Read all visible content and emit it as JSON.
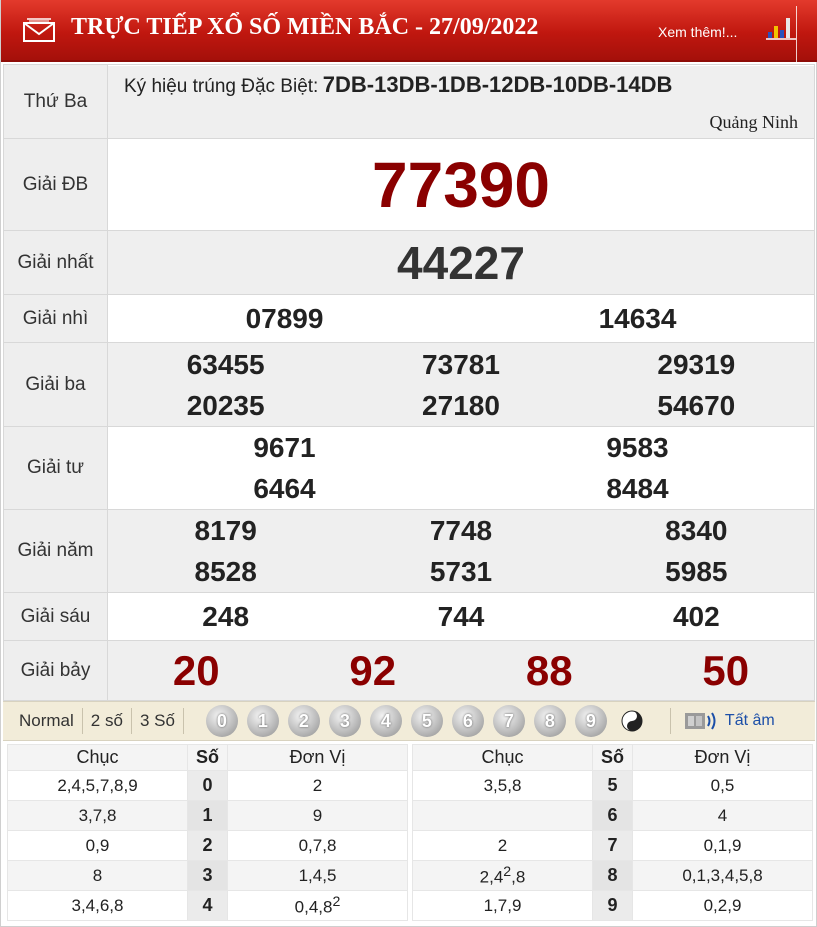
{
  "header": {
    "title": "TRỰC TIẾP XỔ SỐ MIỀN BẮC - 27/09/2022",
    "more_link": "Xem thêm!..."
  },
  "info": {
    "day": "Thứ Ba",
    "code_label": "Ký hiệu trúng Đặc Biệt:",
    "code_value": "7DB-13DB-1DB-12DB-10DB-14DB",
    "province": "Quảng Ninh"
  },
  "prizes": {
    "db": {
      "label": "Giải ĐB",
      "values": [
        "77390"
      ]
    },
    "g1": {
      "label": "Giải nhất",
      "values": [
        "44227"
      ]
    },
    "g2": {
      "label": "Giải nhì",
      "values": [
        "07899",
        "14634"
      ]
    },
    "g3": {
      "label": "Giải ba",
      "values": [
        "63455",
        "73781",
        "29319",
        "20235",
        "27180",
        "54670"
      ]
    },
    "g4": {
      "label": "Giải tư",
      "values": [
        "9671",
        "9583",
        "6464",
        "8484"
      ]
    },
    "g5": {
      "label": "Giải năm",
      "values": [
        "8179",
        "7748",
        "8340",
        "8528",
        "5731",
        "5985"
      ]
    },
    "g6": {
      "label": "Giải sáu",
      "values": [
        "248",
        "744",
        "402"
      ]
    },
    "g7": {
      "label": "Giải bảy",
      "values": [
        "20",
        "92",
        "88",
        "50"
      ]
    }
  },
  "controls": {
    "options": [
      "Normal",
      "2 số",
      "3 Số"
    ],
    "digits": [
      "0",
      "1",
      "2",
      "3",
      "4",
      "5",
      "6",
      "7",
      "8",
      "9"
    ],
    "audio_label": "Tất âm"
  },
  "loto": {
    "headers": {
      "chuc": "Chục",
      "so": "Số",
      "donvi": "Đơn Vị"
    },
    "left": [
      {
        "chuc": "2,4,5,7,8,9",
        "so": "0",
        "donvi": "2"
      },
      {
        "chuc": "3,7,8",
        "so": "1",
        "donvi": "9"
      },
      {
        "chuc": "0,9",
        "so": "2",
        "donvi": "0,7,8"
      },
      {
        "chuc": "8",
        "so": "3",
        "donvi": "1,4,5"
      },
      {
        "chuc": "3,4,6,8",
        "so": "4",
        "donvi": "0,4,8",
        "donvi_sup": "2"
      }
    ],
    "right": [
      {
        "chuc": "3,5,8",
        "so": "5",
        "donvi": "0,5"
      },
      {
        "chuc": "",
        "so": "6",
        "donvi": "4"
      },
      {
        "chuc": "2",
        "so": "7",
        "donvi": "0,1,9"
      },
      {
        "chuc": "2,4",
        "chuc_sup": "2",
        "chuc_tail": ",8",
        "so": "8",
        "donvi": "0,1,3,4,5,8"
      },
      {
        "chuc": "1,7,9",
        "so": "9",
        "donvi": "0,2,9"
      }
    ]
  },
  "colors": {
    "header_red": "#c0170f",
    "prize_red": "#8a0000",
    "audio_blue": "#1c4fa8"
  }
}
